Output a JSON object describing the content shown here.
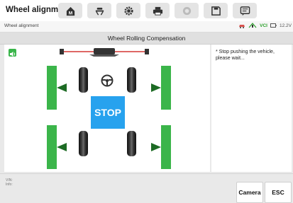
{
  "app": {
    "title": "Wheel alignment"
  },
  "toolbar": {
    "buttons": [
      {
        "name": "home-icon"
      },
      {
        "name": "vehicle-lift-icon"
      },
      {
        "name": "gear-icon"
      },
      {
        "name": "print-icon"
      },
      {
        "name": "help-icon"
      },
      {
        "name": "save-icon"
      },
      {
        "name": "message-icon"
      }
    ]
  },
  "status": {
    "breadcrumb": "Wheel alignment",
    "vci": "VCI",
    "battery": "12.2V"
  },
  "screen": {
    "title": "Wheel Rolling Compensation",
    "stop_label": "STOP",
    "message": "* Stop pushing the vehicle, please wait..."
  },
  "footer": {
    "info_line1": "VIN:",
    "info_line2": "Info:",
    "camera_label": "Camera",
    "esc_label": "ESC"
  },
  "colors": {
    "accent_green": "#39b54a",
    "stop_blue": "#27a2ee",
    "arrow_red": "#d9534f"
  }
}
